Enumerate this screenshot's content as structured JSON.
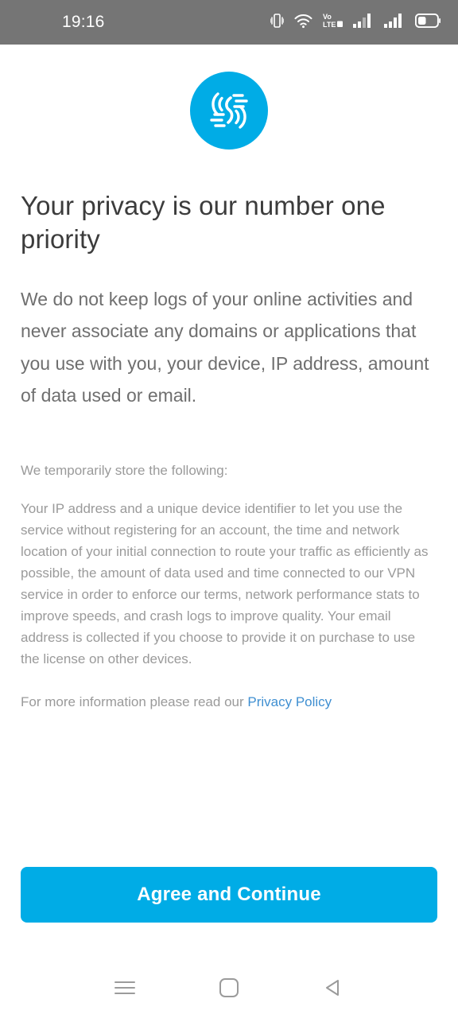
{
  "status_bar": {
    "time": "19:16",
    "background_color": "#757575",
    "icons": [
      {
        "name": "vibrate-icon",
        "label": "Vibrate mode"
      },
      {
        "name": "wifi-icon",
        "label": "Wi-Fi"
      },
      {
        "name": "volte-icon",
        "label": "VoLTE"
      },
      {
        "name": "signal-sim1-icon",
        "label": "Signal SIM 1"
      },
      {
        "name": "signal-sim2-icon",
        "label": "Signal SIM 2"
      },
      {
        "name": "battery-icon",
        "label": "Battery"
      }
    ],
    "volte_text_top": "Vo",
    "volte_text_bottom": "LTE"
  },
  "brand": {
    "logo_name": "windscribe-logo",
    "accent_color": "#00ace6"
  },
  "main": {
    "headline": "Your privacy is our number one priority",
    "lede": "We do not keep logs of your online activities and never associate any domains or applications that you use with you, your device, IP address, amount of data used or email.",
    "store_title": "We temporarily store the following:",
    "store_body": "Your IP address and a unique device identifier to let you use the service without registering for an account, the time and network location of your initial connection to route your traffic as efficiently as possible, the amount of data used and time connected to our VPN service in order to enforce our terms, network performance stats to improve speeds, and crash logs to improve quality. Your email address is collected if you choose to provide it on purchase to use the license on other devices.",
    "policy_prefix": "For more information please read our ",
    "policy_link_label": "Privacy Policy",
    "policy_link_color": "#3f8fd1",
    "cta_label": "Agree and Continue",
    "cta_color": "#00ace6"
  },
  "nav_bar": {
    "recents_label": "Recents",
    "home_label": "Home",
    "back_label": "Back"
  }
}
